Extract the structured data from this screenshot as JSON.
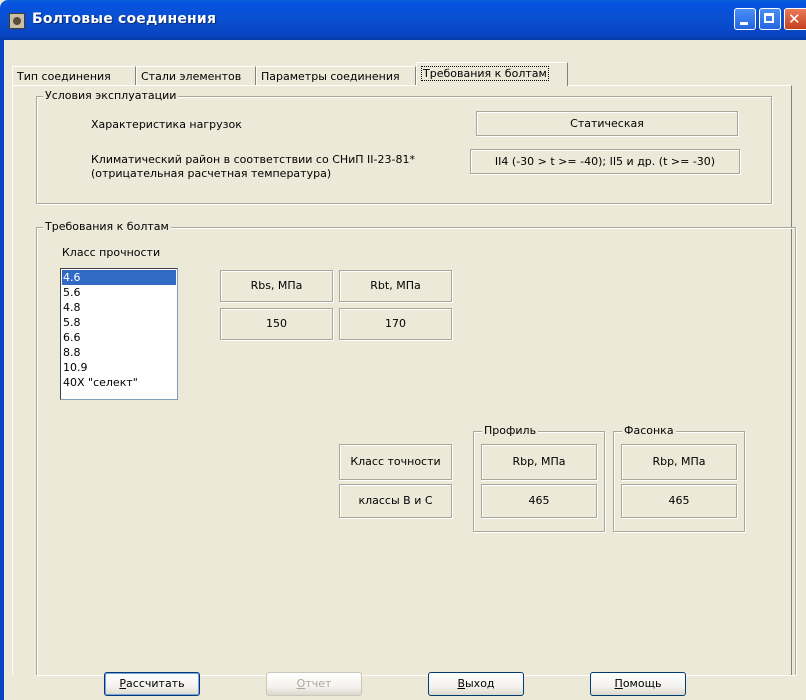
{
  "window": {
    "title": "Болтовые соединения"
  },
  "tabs": [
    {
      "label": "Тип соединения"
    },
    {
      "label": "Стали элементов"
    },
    {
      "label": "Параметры соединения"
    },
    {
      "label": "Требования к  болтам"
    }
  ],
  "operating": {
    "title": "Условия эксплуатации",
    "load_label": "Характеристика нагрузок",
    "load_value": "Статическая",
    "climate_label_line1": "Климатический район в соответствии со СНиП II-23-81*",
    "climate_label_line2": "(отрицательная расчетная температура)",
    "climate_value": "II4 (-30 > t >= -40); II5 и др. (t >= -30)"
  },
  "bolts": {
    "title": "Требования к болтам",
    "strength_class_label": "Класс прочности",
    "strength_classes": [
      "4.6",
      "5.6",
      "4.8",
      "5.8",
      "6.6",
      "8.8",
      "10.9",
      "40X \"селект\""
    ],
    "selected_class": "4.6",
    "rbs_header": "Rbs, МПа",
    "rbt_header": "Rbt, МПа",
    "rbs_value": "150",
    "rbt_value": "170",
    "accuracy_label": "Класс точности",
    "accuracy_value": "классы В и С",
    "profile": {
      "title": "Профиль",
      "header": "Rbp, МПа",
      "value": "465"
    },
    "gusset": {
      "title": "Фасонка",
      "header": "Rbp, МПа",
      "value": "465"
    }
  },
  "buttons": {
    "calculate": {
      "underline": "Р",
      "rest": "ассчитать"
    },
    "report": {
      "underline": "О",
      "rest": "тчет"
    },
    "exit": {
      "underline": "В",
      "rest": "ыход"
    },
    "help": {
      "underline": "П",
      "rest": "омощь"
    }
  }
}
